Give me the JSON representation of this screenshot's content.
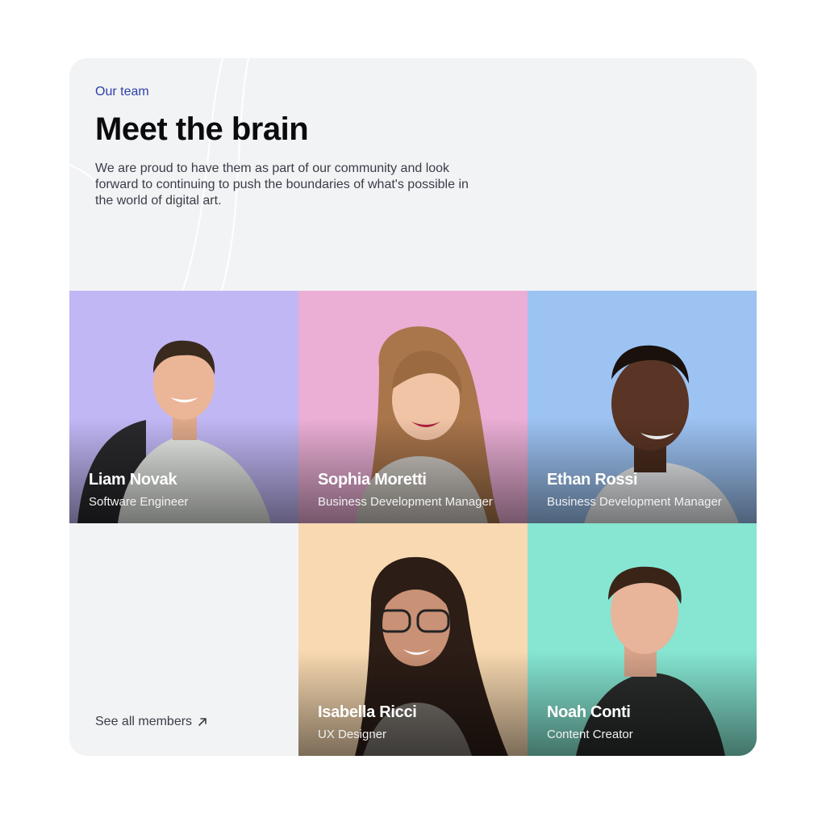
{
  "section": {
    "eyebrow": "Our team",
    "title": "Meet the brain",
    "description": "We are proud to have them as part of our community and look forward to continuing to push the boundaries of what's possible in the world of digital art.",
    "see_all_label": "See all members",
    "see_all_icon": "arrow-up-right-icon"
  },
  "members": [
    {
      "name": "Liam Novak",
      "role": "Software Engineer",
      "bg": "#c1b7f5"
    },
    {
      "name": "Sophia Moretti",
      "role": "Business Development Manager",
      "bg": "#ebaed5"
    },
    {
      "name": "Ethan Rossi",
      "role": "Business Development Manager",
      "bg": "#9dc3f3"
    },
    {
      "name": "Isabella Ricci",
      "role": "UX Designer",
      "bg": "#f8d9b1"
    },
    {
      "name": "Noah Conti",
      "role": "Content Creator",
      "bg": "#86e6d2"
    }
  ],
  "colors": {
    "card_bg": "#f2f3f5",
    "eyebrow": "#2d3ea8",
    "title": "#0b0b0f",
    "body_text": "#3a3d46"
  }
}
